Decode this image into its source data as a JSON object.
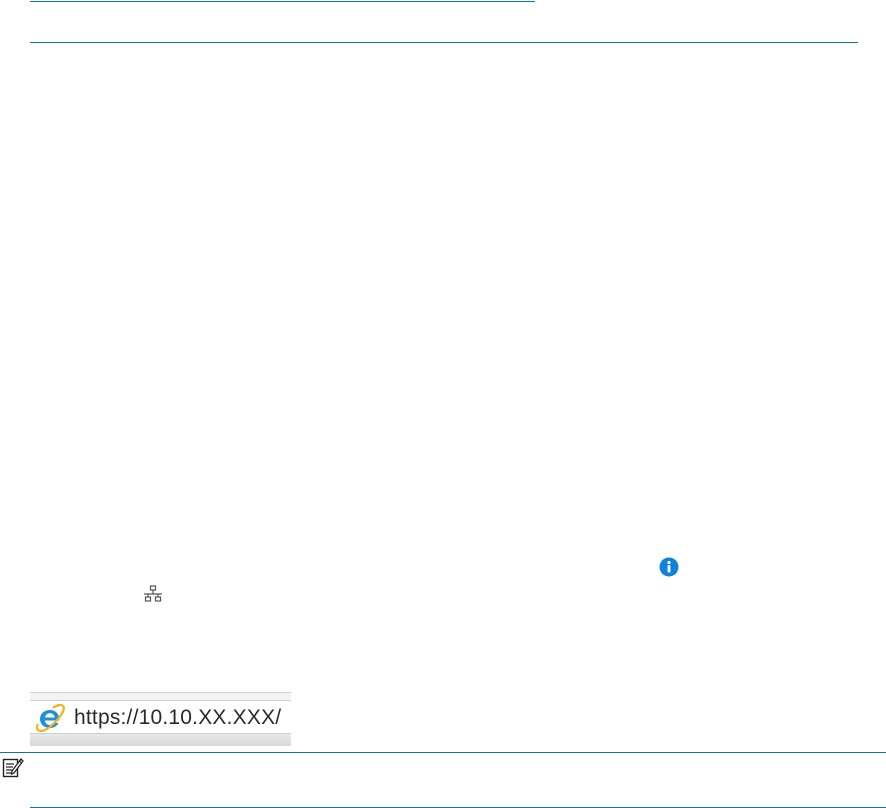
{
  "address_bar": {
    "url": "https://10.10.XX.XXX/"
  },
  "icons": {
    "info": "info-icon",
    "network": "network-icon",
    "browser": "internet-explorer-icon",
    "note": "note-icon"
  },
  "colors": {
    "rule": "#0e74b4",
    "info_icon": "#1082d8"
  }
}
